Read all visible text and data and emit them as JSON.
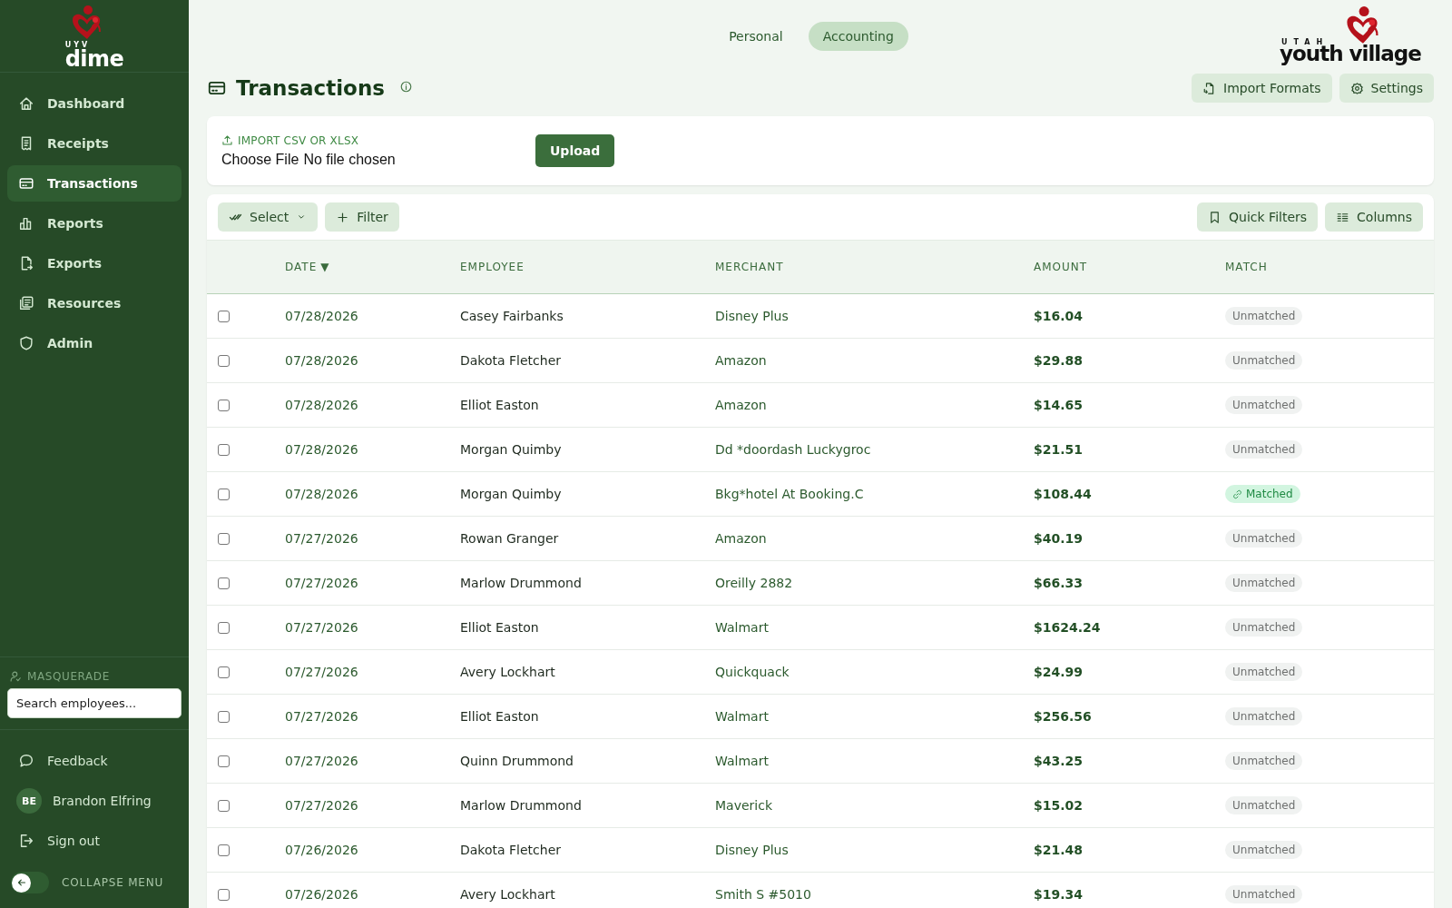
{
  "brand": {
    "small": "UYV",
    "name": "dime"
  },
  "nav": [
    {
      "label": "Dashboard",
      "selected": false
    },
    {
      "label": "Receipts",
      "selected": false
    },
    {
      "label": "Transactions",
      "selected": true
    },
    {
      "label": "Reports",
      "selected": false
    },
    {
      "label": "Exports",
      "selected": false
    },
    {
      "label": "Resources",
      "selected": false
    },
    {
      "label": "Admin",
      "selected": false
    }
  ],
  "masquerade": {
    "label": "MASQUERADE",
    "placeholder": "Search employees..."
  },
  "footer": [
    {
      "kind": "feedback",
      "label": "Feedback"
    },
    {
      "kind": "user",
      "initials": "BE",
      "label": "Brandon Elfring"
    },
    {
      "kind": "signout",
      "label": "Sign out"
    }
  ],
  "collapse": {
    "label": "COLLAPSE MENU",
    "on": false
  },
  "mode_tabs": [
    {
      "label": "Personal",
      "selected": false
    },
    {
      "label": "Accounting",
      "selected": true
    }
  ],
  "org_logo": {
    "small": "UTAH",
    "name": "youth village"
  },
  "page": {
    "title": "Transactions"
  },
  "header_buttons": [
    {
      "label": "Import Formats"
    },
    {
      "label": "Settings"
    }
  ],
  "import": {
    "label": "IMPORT CSV OR XLSX",
    "file_button": "Choose File",
    "file_status": "No file chosen",
    "upload": "Upload"
  },
  "toolbar": {
    "left": [
      {
        "label": "Select"
      },
      {
        "label": "Filter"
      }
    ],
    "right": [
      {
        "label": "Quick Filters"
      },
      {
        "label": "Columns"
      }
    ]
  },
  "table": {
    "columns": [
      {
        "label": "DATE",
        "sort": "▼"
      },
      {
        "label": "EMPLOYEE"
      },
      {
        "label": "MERCHANT"
      },
      {
        "label": "AMOUNT"
      },
      {
        "label": "MATCH"
      }
    ],
    "rows": [
      {
        "checked": false,
        "date": "07/28/2026",
        "employee": "Casey Fairbanks",
        "merchant": "Disney Plus",
        "amount": "$16.04",
        "match": "Unmatched",
        "matched": false
      },
      {
        "checked": false,
        "date": "07/28/2026",
        "employee": "Dakota Fletcher",
        "merchant": "Amazon",
        "amount": "$29.88",
        "match": "Unmatched",
        "matched": false
      },
      {
        "checked": false,
        "date": "07/28/2026",
        "employee": "Elliot Easton",
        "merchant": "Amazon",
        "amount": "$14.65",
        "match": "Unmatched",
        "matched": false
      },
      {
        "checked": false,
        "date": "07/28/2026",
        "employee": "Morgan Quimby",
        "merchant": "Dd *doordash Luckygroc",
        "amount": "$21.51",
        "match": "Unmatched",
        "matched": false
      },
      {
        "checked": false,
        "date": "07/28/2026",
        "employee": "Morgan Quimby",
        "merchant": "Bkg*hotel At Booking.C",
        "amount": "$108.44",
        "match": "Matched",
        "matched": true
      },
      {
        "checked": false,
        "date": "07/27/2026",
        "employee": "Rowan Granger",
        "merchant": "Amazon",
        "amount": "$40.19",
        "match": "Unmatched",
        "matched": false
      },
      {
        "checked": false,
        "date": "07/27/2026",
        "employee": "Marlow Drummond",
        "merchant": "Oreilly 2882",
        "amount": "$66.33",
        "match": "Unmatched",
        "matched": false
      },
      {
        "checked": false,
        "date": "07/27/2026",
        "employee": "Elliot Easton",
        "merchant": "Walmart",
        "amount": "$1624.24",
        "match": "Unmatched",
        "matched": false
      },
      {
        "checked": false,
        "date": "07/27/2026",
        "employee": "Avery Lockhart",
        "merchant": "Quickquack",
        "amount": "$24.99",
        "match": "Unmatched",
        "matched": false
      },
      {
        "checked": false,
        "date": "07/27/2026",
        "employee": "Elliot Easton",
        "merchant": "Walmart",
        "amount": "$256.56",
        "match": "Unmatched",
        "matched": false
      },
      {
        "checked": false,
        "date": "07/27/2026",
        "employee": "Quinn Drummond",
        "merchant": "Walmart",
        "amount": "$43.25",
        "match": "Unmatched",
        "matched": false
      },
      {
        "checked": false,
        "date": "07/27/2026",
        "employee": "Marlow Drummond",
        "merchant": "Maverick",
        "amount": "$15.02",
        "match": "Unmatched",
        "matched": false
      },
      {
        "checked": false,
        "date": "07/26/2026",
        "employee": "Dakota Fletcher",
        "merchant": "Disney Plus",
        "amount": "$21.48",
        "match": "Unmatched",
        "matched": false
      },
      {
        "checked": false,
        "date": "07/26/2026",
        "employee": "Avery Lockhart",
        "merchant": "Smith S #5010",
        "amount": "$19.34",
        "match": "Unmatched",
        "matched": false
      }
    ]
  }
}
